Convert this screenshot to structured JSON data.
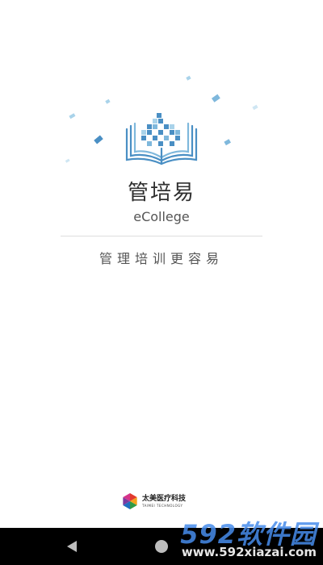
{
  "app": {
    "name": "管培易",
    "subtitle": "eCollege",
    "slogan": "管理培训更容易"
  },
  "company": {
    "name": "太美医疗科技",
    "name_en": "TAIMEI TECHNOLOGY"
  },
  "watermark": {
    "brand": "592软件园",
    "url": "www.592xiazai.com"
  },
  "colors": {
    "logo_blue": "#4a8fc4",
    "logo_light": "#a9d3ea",
    "text_dark": "#2f2f2f",
    "navbar": "#000000"
  },
  "icons": {
    "logo": "book-pixel-logo",
    "company_logo": "color-hexagon-logo",
    "nav_back": "back-triangle-icon",
    "nav_home": "home-circle-icon"
  }
}
